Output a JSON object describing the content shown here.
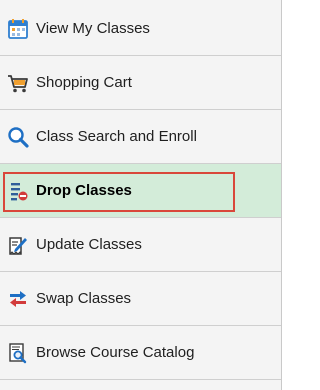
{
  "menu": {
    "items": [
      {
        "label": "View My Classes",
        "icon": "calendar-icon"
      },
      {
        "label": "Shopping Cart",
        "icon": "shopping-cart-icon"
      },
      {
        "label": "Class Search and Enroll",
        "icon": "search-icon"
      },
      {
        "label": "Drop Classes",
        "icon": "drop-list-icon",
        "selected": true
      },
      {
        "label": "Update Classes",
        "icon": "edit-document-icon"
      },
      {
        "label": "Swap Classes",
        "icon": "swap-arrows-icon"
      },
      {
        "label": "Browse Course Catalog",
        "icon": "catalog-search-icon"
      }
    ]
  },
  "colors": {
    "selected_background": "#d3ecd9",
    "highlight_border": "#d9473a",
    "menu_background": "#f4f4f4"
  }
}
